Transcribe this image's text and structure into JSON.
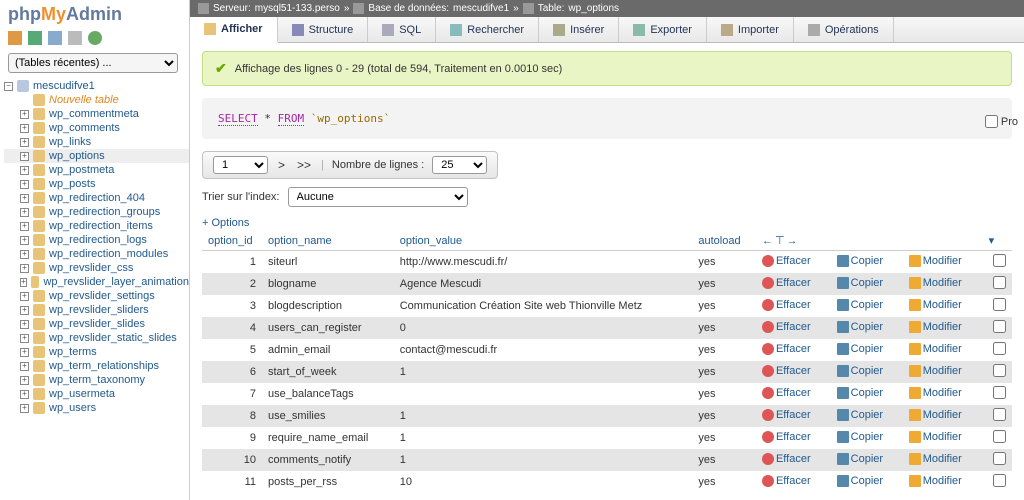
{
  "logo": {
    "php": "php",
    "my": "My",
    "admin": "Admin"
  },
  "recent_tables": "(Tables récentes) ...",
  "db_name": "mescudifve1",
  "new_table": "Nouvelle table",
  "tree": [
    "wp_commentmeta",
    "wp_comments",
    "wp_links",
    "wp_options",
    "wp_postmeta",
    "wp_posts",
    "wp_redirection_404",
    "wp_redirection_groups",
    "wp_redirection_items",
    "wp_redirection_logs",
    "wp_redirection_modules",
    "wp_revslider_css",
    "wp_revslider_layer_animation",
    "wp_revslider_settings",
    "wp_revslider_sliders",
    "wp_revslider_slides",
    "wp_revslider_static_slides",
    "wp_terms",
    "wp_term_relationships",
    "wp_term_taxonomy",
    "wp_usermeta",
    "wp_users"
  ],
  "selected_table": "wp_options",
  "crumbs": {
    "server_lbl": "Serveur:",
    "server": "mysql51-133.perso",
    "db_lbl": "Base de données:",
    "db": "mescudifve1",
    "tbl_lbl": "Table:",
    "tbl": "wp_options",
    "sep": "»"
  },
  "tabs": {
    "browse": "Afficher",
    "structure": "Structure",
    "sql": "SQL",
    "search": "Rechercher",
    "insert": "Insérer",
    "export": "Exporter",
    "import": "Importer",
    "operations": "Opérations"
  },
  "success_msg": "Affichage des lignes 0 - 29 (total de 594, Traitement en 0.0010 sec)",
  "query": {
    "select": "SELECT",
    "star": "*",
    "from": "FROM",
    "table": "`wp_options`"
  },
  "profiling": "Pro",
  "pager": {
    "page": "1",
    "next": ">",
    "last": ">>",
    "rows_lbl": "Nombre de lignes :",
    "rows": "25"
  },
  "sort": {
    "lbl": "Trier sur l'index:",
    "value": "Aucune"
  },
  "options": "+ Options",
  "columns": {
    "c1": "option_id",
    "c2": "option_name",
    "c3": "option_value",
    "c4": "autoload"
  },
  "action_lbl": {
    "del": "Effacer",
    "copy": "Copier",
    "edit": "Modifier"
  },
  "header_tools": "←⊤→",
  "header_drop": "▾",
  "rows": [
    {
      "id": "1",
      "name": "siteurl",
      "value": "http://www.mescudi.fr/",
      "auto": "yes"
    },
    {
      "id": "2",
      "name": "blogname",
      "value": "Agence Mescudi",
      "auto": "yes"
    },
    {
      "id": "3",
      "name": "blogdescription",
      "value": "Communication Création Site web Thionville Metz",
      "auto": "yes"
    },
    {
      "id": "4",
      "name": "users_can_register",
      "value": "0",
      "auto": "yes"
    },
    {
      "id": "5",
      "name": "admin_email",
      "value": "contact@mescudi.fr",
      "auto": "yes"
    },
    {
      "id": "6",
      "name": "start_of_week",
      "value": "1",
      "auto": "yes"
    },
    {
      "id": "7",
      "name": "use_balanceTags",
      "value": "",
      "auto": "yes"
    },
    {
      "id": "8",
      "name": "use_smilies",
      "value": "1",
      "auto": "yes"
    },
    {
      "id": "9",
      "name": "require_name_email",
      "value": "1",
      "auto": "yes"
    },
    {
      "id": "10",
      "name": "comments_notify",
      "value": "1",
      "auto": "yes"
    },
    {
      "id": "11",
      "name": "posts_per_rss",
      "value": "10",
      "auto": "yes"
    }
  ]
}
